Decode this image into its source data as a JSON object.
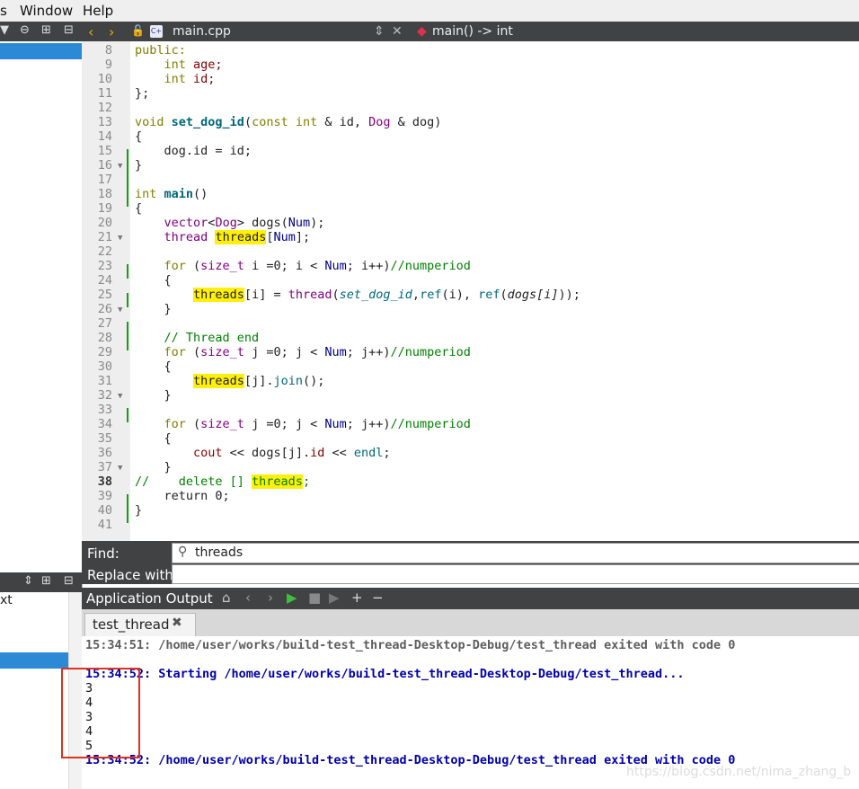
{
  "menu": {
    "partial_left": "s",
    "window": "Window",
    "help": "Help"
  },
  "editor_tab": {
    "file_name": "main.cpp",
    "function": "main() -> int"
  },
  "code": {
    "line_numbers": [
      "8",
      "9",
      "10",
      "11",
      "12",
      "13",
      "14",
      "15",
      "16",
      "17",
      "18",
      "19",
      "20",
      "21",
      "22",
      "23",
      "24",
      "25",
      "26",
      "27",
      "28",
      "29",
      "30",
      "31",
      "32",
      "33",
      "34",
      "35",
      "36",
      "37",
      "38",
      "39",
      "40",
      "41"
    ],
    "current_line": "38",
    "text": {
      "public": "public:",
      "int": "int",
      "age": "age;",
      "id_decl": "id;",
      "close_struct": "};",
      "void": "void",
      "set_dog_id": "set_dog_id",
      "params_open": "(",
      "const_int": "const int",
      "amp_id": " & id, ",
      "dog_type": "Dog",
      "amp_dog": " & dog)",
      "brace_open": "{",
      "brace_close": "}",
      "dog_id_assign": "dog.id = id;",
      "main": "main",
      "main_parens": "()",
      "vector": "vector",
      "lt": "<",
      "gt": "> dogs(",
      "num": "Num",
      "close_paren_semi": ");",
      "thread": "thread",
      "threads": "threads",
      "arr_num_open": "[",
      "arr_num_close": "];",
      "for": "for",
      "size_t": "size_t",
      "loop_i_open": " (",
      "loop_i_var": " i =0; i < ",
      "loop_i_rest": "; i++)",
      "comment_numperiod": "//numperiod",
      "idx_i": "[i] = ",
      "thread_call_open": "(",
      "set_dog_id_call": "set_dog_id",
      "comma_ref": ",",
      "ref": "ref",
      "ref_i": "(i), ",
      "ref2_open": "(",
      "dogs_i": "dogs[i]",
      "call_close": "));",
      "comment_thread_end": "// Thread end",
      "loop_j_var": " j =0; j < ",
      "loop_j_rest": "; j++)",
      "idx_j": "[j].",
      "join": "join",
      "join_close": "();",
      "cout": "cout",
      "cout_rest": " << dogs[j].",
      "id_member": "id",
      "shift": " << ",
      "endl": "endl",
      "semi": ";",
      "comment_delete_prefix": "//    delete [] ",
      "return_line": "return 0;"
    }
  },
  "find": {
    "find_label": "Find:",
    "query": "threads",
    "replace_label": "Replace with:",
    "replace_value": ""
  },
  "output": {
    "pane_title": "Application Output",
    "tab_label": "test_thread",
    "lines": {
      "l1": "15:34:51: /home/user/works/build-test_thread-Desktop-Debug/test_thread exited with code 0",
      "l2": "15:34:52: Starting /home/user/works/build-test_thread-Desktop-Debug/test_thread...",
      "v1": "3",
      "v2": "4",
      "v3": "3",
      "v4": "4",
      "v5": "5",
      "l3": "15:34:52: /home/user/works/build-test_thread-Desktop-Debug/test_thread exited with code 0"
    }
  },
  "left_pane": {
    "partial_text": "xt"
  },
  "watermark": "https://blog.csdn.net/nima_zhang_b",
  "colors": {
    "highlight": "#ffef0b",
    "selection": "#2b89d6",
    "toolbar": "#404244",
    "annotation_box": "#e0301e"
  },
  "icons": [
    "filter-icon",
    "link-icon",
    "split-icon",
    "close-pane-icon",
    "back-icon",
    "forward-icon",
    "lock-icon",
    "cpp-file-icon",
    "updown-icon",
    "close-icon",
    "function-icon",
    "search-icon",
    "broom-icon",
    "run-icon",
    "stop-icon",
    "debug-icon",
    "plus-icon",
    "minus-icon"
  ]
}
